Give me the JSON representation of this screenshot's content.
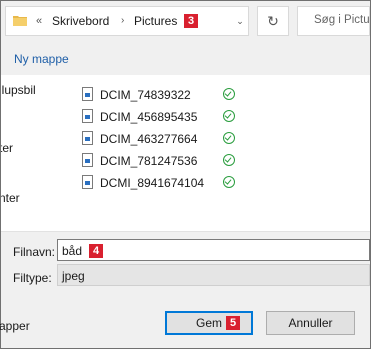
{
  "address_bar": {
    "nav_back_glyph": "«",
    "breadcrumbs": [
      "Skrivebord",
      "Pictures"
    ],
    "badge": "3",
    "refresh_glyph": "↻",
    "search_placeholder": "Søg i Pictu"
  },
  "toolbar": {
    "new_folder_label": "Ny mappe"
  },
  "nav_pane": {
    "items": [
      "llupsbil",
      "ter",
      "nter"
    ]
  },
  "files": [
    {
      "name": "DCIM_74839322",
      "status_icon": "synced-check-icon"
    },
    {
      "name": "DCIM_456895435",
      "status_icon": "synced-check-icon"
    },
    {
      "name": "DCIM_463277664",
      "status_icon": "synced-check-icon"
    },
    {
      "name": "DCIM_781247536",
      "status_icon": "synced-check-icon"
    },
    {
      "name": "DCMI_8941674104",
      "status_icon": "synced-check-icon"
    }
  ],
  "filename": {
    "label": "Filnavn:",
    "value": "båd",
    "badge": "4"
  },
  "filetype": {
    "label": "Filtype:",
    "value": "jpeg"
  },
  "footer": {
    "left_text": "apper",
    "save_label": "Gem",
    "save_badge": "5",
    "cancel_label": "Annuller"
  },
  "colors": {
    "badge_red": "#d9202f",
    "link_blue": "#1f5fa8",
    "focus_blue": "#0078d7",
    "sync_green": "#2a9d3e"
  }
}
